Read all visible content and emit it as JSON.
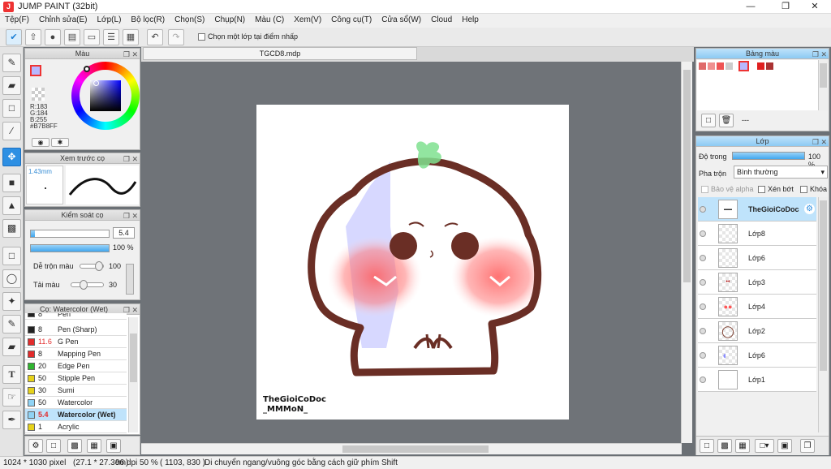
{
  "window": {
    "title": "JUMP PAINT (32bit)",
    "app_icon": "J"
  },
  "menu": [
    "Tệp(F)",
    "Chỉnh sửa(E)",
    "Lớp(L)",
    "Bộ lọc(R)",
    "Chọn(S)",
    "Chụp(N)",
    "Màu (C)",
    "Xem(V)",
    "Công cụ(T)",
    "Cửa sổ(W)",
    "Cloud",
    "Help"
  ],
  "toolbar": {
    "snap_label": "Chọn một lớp tại điểm nhấp"
  },
  "document": {
    "tab": "TGCD8.mdp"
  },
  "color_panel": {
    "title": "Màu",
    "r": "R:183",
    "g": "G:184",
    "b": "B:255",
    "hex": "#B7B8FF",
    "current_color": "#b7b8ff"
  },
  "brush_preview": {
    "title": "Xem trước cọ",
    "size": "1.43mm"
  },
  "brush_control": {
    "title": "Kiểm soát cọ",
    "size_value": "5.4",
    "opacity_value": "100 %",
    "mix_label": "Dễ trộn màu",
    "mix_value": "100",
    "reload_label": "Tải màu",
    "reload_value": "30"
  },
  "brush_list": {
    "title": "Cọ: Watercolor (Wet)",
    "items": [
      {
        "size": "8",
        "name": "Pen",
        "color": "#222222"
      },
      {
        "size": "8",
        "name": "Pen (Sharp)",
        "color": "#222222"
      },
      {
        "size": "11.6",
        "name": "G Pen",
        "color": "#e22b2b"
      },
      {
        "size": "8",
        "name": "Mapping Pen",
        "color": "#e22b2b"
      },
      {
        "size": "20",
        "name": "Edge Pen",
        "color": "#2fb52f"
      },
      {
        "size": "50",
        "name": "Stipple Pen",
        "color": "#e6d21a"
      },
      {
        "size": "30",
        "name": "Sumi",
        "color": "#e6d21a"
      },
      {
        "size": "50",
        "name": "Watercolor",
        "color": "#8fd3f5"
      },
      {
        "size": "5.4",
        "name": "Watercolor (Wet)",
        "color": "#8fd3f5"
      },
      {
        "size": "1",
        "name": "Acrylic",
        "color": "#e6d21a"
      }
    ]
  },
  "palette": {
    "title": "Bảng màu",
    "swatches": [
      "#e06a6a",
      "#f09090",
      "#ee5555",
      "#cccccc",
      "#b7b8ff",
      "#e02020",
      "#aa3333"
    ],
    "dash": "---"
  },
  "layers": {
    "title": "Lớp",
    "opacity_label": "Độ trong",
    "opacity_value": "100 %",
    "blend_label": "Pha trộn",
    "blend_value": "Bình thường",
    "protect_alpha": "Bảo vệ alpha",
    "clipping": "Xén bớt",
    "lock": "Khóa",
    "items": [
      "TheGioiCoDoc",
      "Lớp8",
      "Lớp6",
      "Lớp3",
      "Lớp4",
      "Lớp2",
      "Lớp6",
      "Lớp1"
    ]
  },
  "canvas": {
    "watermark_line1": "TheGioiCoDoc",
    "watermark_line2": "_MMMoN_"
  },
  "status": {
    "size": "1024 * 1030 pixel",
    "dims": "(27.1 * 27.3cm)",
    "dpi": "96 dpi",
    "zoom": "50 %",
    "coords": "( 1103, 830 )",
    "hint": "Di chuyển ngang/vuông góc bằng cách giữ phím Shift"
  }
}
